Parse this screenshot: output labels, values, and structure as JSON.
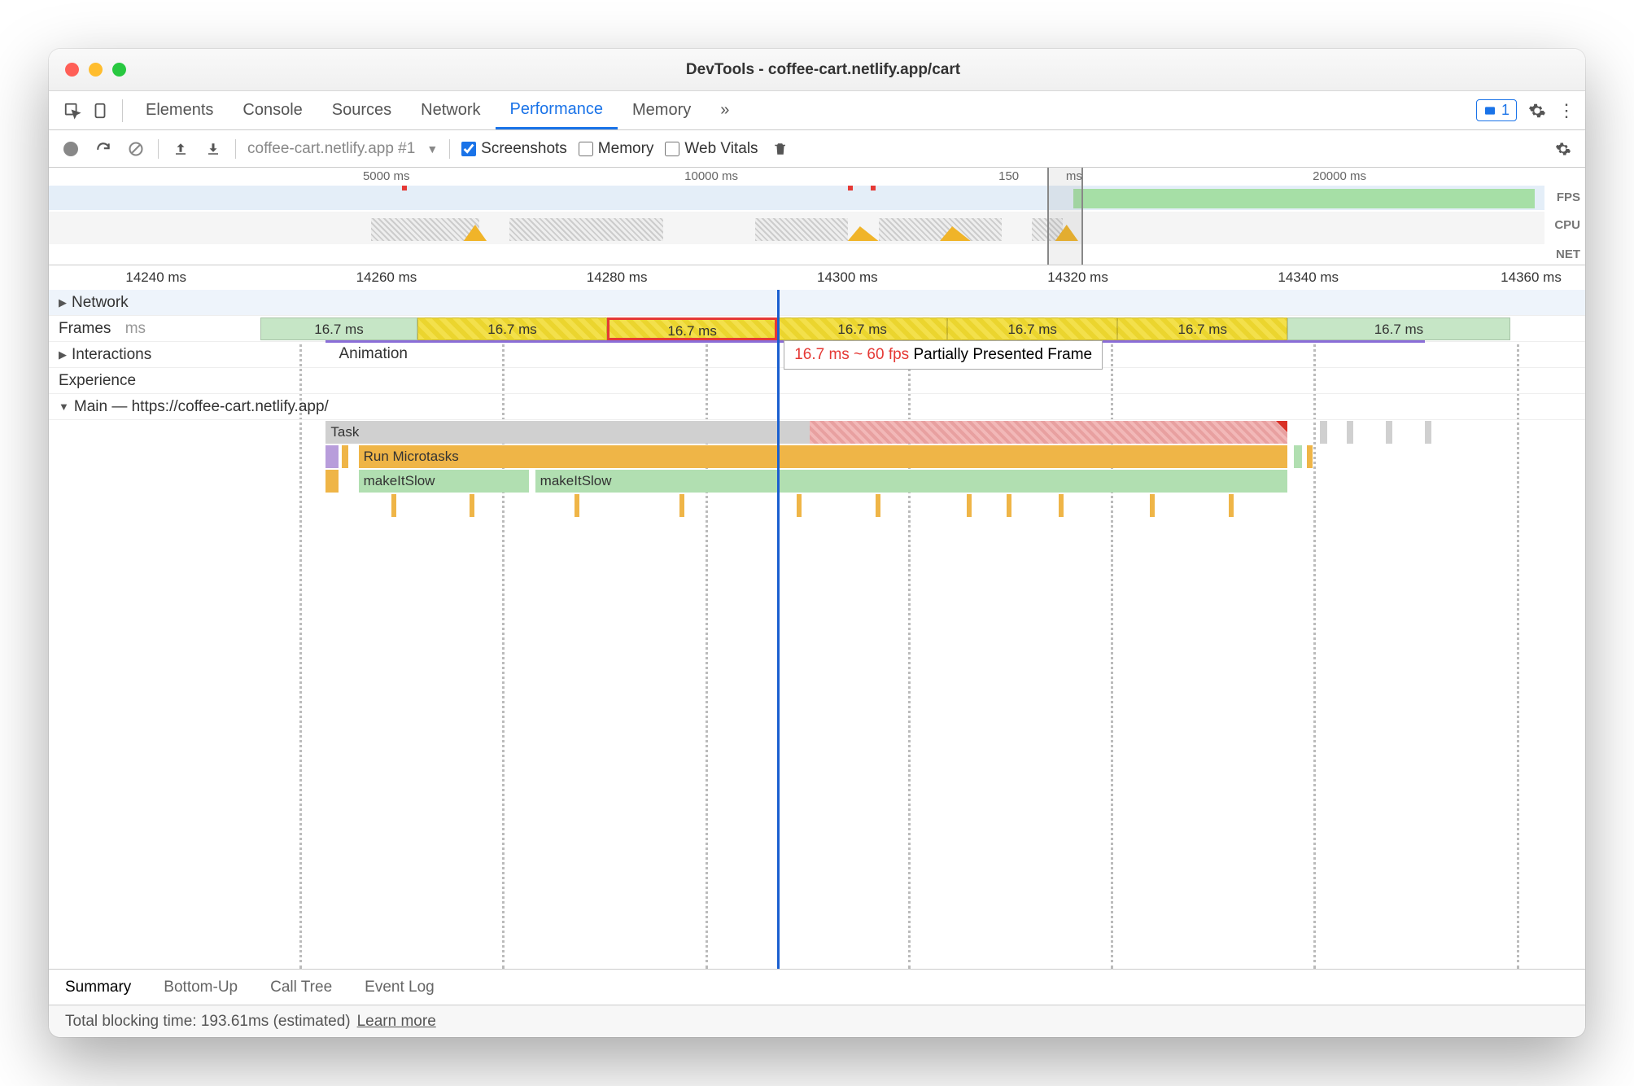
{
  "window_title": "DevTools - coffee-cart.netlify.app/cart",
  "tabs": [
    "Elements",
    "Console",
    "Sources",
    "Network",
    "Performance",
    "Memory"
  ],
  "active_tab": "Performance",
  "badge_count": "1",
  "toolbar": {
    "recording_name": "coffee-cart.netlify.app #1",
    "screenshots_label": "Screenshots",
    "memory_label": "Memory",
    "webvitals_label": "Web Vitals"
  },
  "overview_ticks": [
    "5000 ms",
    "10000 ms",
    "150",
    "ms",
    "20000 ms"
  ],
  "overview_labels": {
    "fps": "FPS",
    "cpu": "CPU",
    "net": "NET"
  },
  "ruler_ticks": [
    "14240 ms",
    "14260 ms",
    "14280 ms",
    "14300 ms",
    "14320 ms",
    "14340 ms",
    "14360 ms"
  ],
  "track_labels": {
    "network": "Network",
    "frames": "Frames",
    "frames_ms": "ms",
    "interactions": "Interactions",
    "experience": "Experience",
    "main": "Main — https://coffee-cart.netlify.app/"
  },
  "frame_values": [
    "16.7 ms",
    "16.7 ms",
    "16.7 ms",
    "16.7 ms",
    "16.7 ms",
    "16.7 ms",
    "16.7 ms"
  ],
  "animation_label": "Animation",
  "tooltip": {
    "timing": "16.7 ms ~ 60 fps",
    "desc": "Partially Presented Frame"
  },
  "flame": {
    "task": "Task",
    "microtasks": "Run Microtasks",
    "fn1": "makeItSlow",
    "fn2": "makeItSlow"
  },
  "bottom_tabs": [
    "Summary",
    "Bottom-Up",
    "Call Tree",
    "Event Log"
  ],
  "active_bottom_tab": "Summary",
  "status": {
    "text": "Total blocking time: 193.61ms (estimated)",
    "link": "Learn more"
  }
}
